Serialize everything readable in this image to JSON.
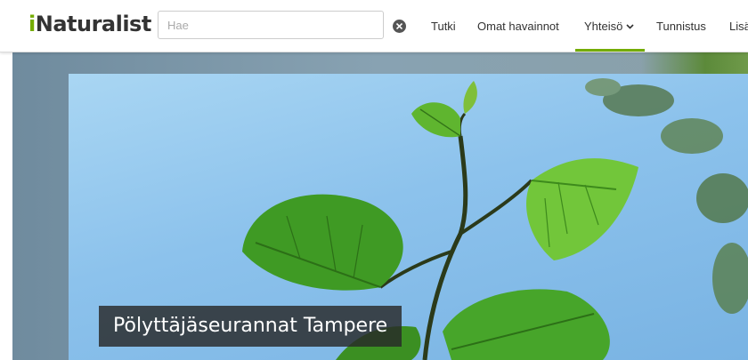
{
  "header": {
    "logo_i": "i",
    "logo_rest": "Naturalist",
    "search": {
      "placeholder": "Hae",
      "value": ""
    },
    "clear_icon": "close-circle-icon",
    "nav": {
      "explore": "Tutki",
      "my_observations": "Omat havainnot",
      "community": "Yhteisö",
      "identify": "Tunnistus",
      "more": "Lisä"
    },
    "active_nav": "community"
  },
  "hero": {
    "title": "Pölyttäjäseurannat Tampere"
  },
  "colors": {
    "brand_green": "#74ac00",
    "text": "#333333",
    "title_overlay": "#282828"
  }
}
